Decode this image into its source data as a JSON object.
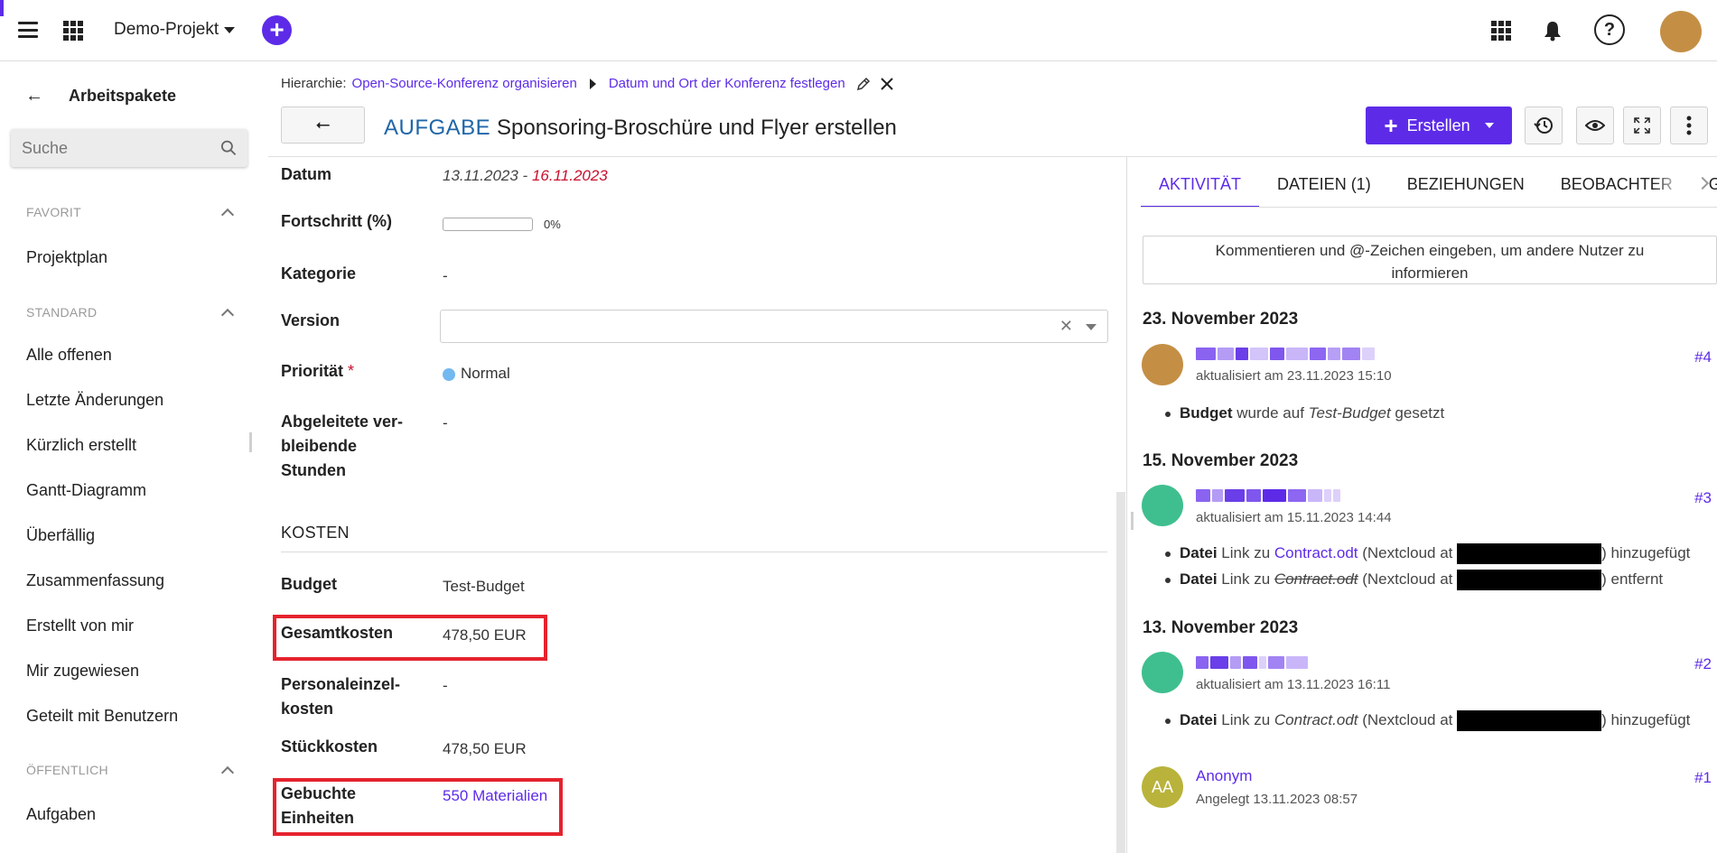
{
  "topbar": {
    "project_name": "Demo-Projekt",
    "help_label": "?"
  },
  "sidebar": {
    "back_label": "←",
    "title": "Arbeitspakete",
    "search_placeholder": "Suche",
    "sections": {
      "favorit": "FAVORIT",
      "standard": "STANDARD",
      "oeffentlich": "ÖFFENTLICH"
    },
    "items": {
      "projektplan": "Projektplan",
      "alle_offenen": "Alle offenen",
      "letzte_aenderungen": "Letzte Änderungen",
      "kuerzlich_erstellt": "Kürzlich erstellt",
      "gantt": "Gantt-Diagramm",
      "ueberfaellig": "Überfällig",
      "zusammenfassung": "Zusammenfassung",
      "erstellt_von_mir": "Erstellt von mir",
      "mir_zugewiesen": "Mir zugewiesen",
      "geteilt": "Geteilt mit Benutzern",
      "aufgaben": "Aufgaben"
    }
  },
  "breadcrumb": {
    "prefix": "Hierarchie:",
    "parent": "Open-Source-Konferenz organisieren",
    "current": "Datum und Ort der Konferenz festlegen"
  },
  "header": {
    "back_label": "⭠",
    "type": "AUFGABE",
    "title": "Sponsoring-Broschüre und Flyer erstellen",
    "create_label": "Erstellen"
  },
  "fields": {
    "datum_label": "Datum",
    "datum_start": "13.11.2023",
    "datum_sep": " - ",
    "datum_end": "16.11.2023",
    "fortschritt_label": "Fortschritt (%)",
    "fortschritt_value": "0%",
    "fortschritt_fraction": 0,
    "kategorie_label": "Kategorie",
    "kategorie_value": "-",
    "version_label": "Version",
    "version_value": "",
    "prioritaet_label": "Priorität",
    "prioritaet_req": "*",
    "prioritaet_value": "Normal",
    "abgeleitete_label_1": "Abgeleitete ver-",
    "abgeleitete_label_2": "bleibende",
    "abgeleitete_label_3": "Stunden",
    "abgeleitete_value": "-"
  },
  "kosten": {
    "heading": "KOSTEN",
    "budget_label": "Budget",
    "budget_value": "Test-Budget",
    "gesamt_label": "Gesamtkosten",
    "gesamt_value": "478,50 EUR",
    "personal_label_1": "Personaleinzel-",
    "personal_label_2": "kosten",
    "personal_value": "-",
    "stueck_label": "Stückkosten",
    "stueck_value": "478,50 EUR",
    "einheiten_label_1": "Gebuchte",
    "einheiten_label_2": "Einheiten",
    "einheiten_value": "550 Materialien"
  },
  "tabs": {
    "aktivitaet": "AKTIVITÄT",
    "dateien": "DATEIEN (1)",
    "beziehungen": "BEZIEHUNGEN",
    "beobachter": "BEOBACHTER",
    "git": "GIT"
  },
  "activity": {
    "comment_placeholder_1": "Kommentieren und @-Zeichen eingeben, um andere Nutzer zu",
    "comment_placeholder_2": "informieren",
    "groups": [
      {
        "date": "23. November 2023",
        "sub": "aktualisiert am 23.11.2023 15:10",
        "num": "#4",
        "avatar_color": "#c48f45",
        "l1_b": "Budget",
        "l1_t1": " wurde auf ",
        "l1_i": "Test-Budget",
        "l1_t2": " gesetzt"
      },
      {
        "date": "15. November 2023",
        "sub": "aktualisiert am 15.11.2023 14:44",
        "num": "#3",
        "avatar_color": "#3fbf8f",
        "l1_b": "Datei",
        "l1_t1": " Link zu ",
        "l1_link": "Contract.odt",
        "l1_t2": " (Nextcloud at ",
        "l1_t3": ") hinzugefügt",
        "l2_b": "Datei",
        "l2_t1": " Link zu ",
        "l2_s": "Contract.odt",
        "l2_t2": " (Nextcloud at ",
        "l2_t3": ") entfernt"
      },
      {
        "date": "13. November 2023",
        "sub": "aktualisiert am 13.11.2023 16:11",
        "num": "#2",
        "avatar_color": "#3fbf8f",
        "l1_b": "Datei",
        "l1_t1": " Link zu ",
        "l1_i": "Contract.odt",
        "l1_t2": " (Nextcloud at ",
        "l1_t3": ") hinzugefügt"
      }
    ],
    "anon": {
      "initials": "AA",
      "name": "Anonym",
      "sub": "Angelegt 13.11.2023 08:57",
      "num": "#1",
      "avatar_color": "#b9b33b"
    }
  },
  "colors": {
    "accent": "#5d2be8",
    "type_blue": "#1f66a8",
    "overdue_red": "#c8102e",
    "highlight_red": "#e5232e"
  }
}
